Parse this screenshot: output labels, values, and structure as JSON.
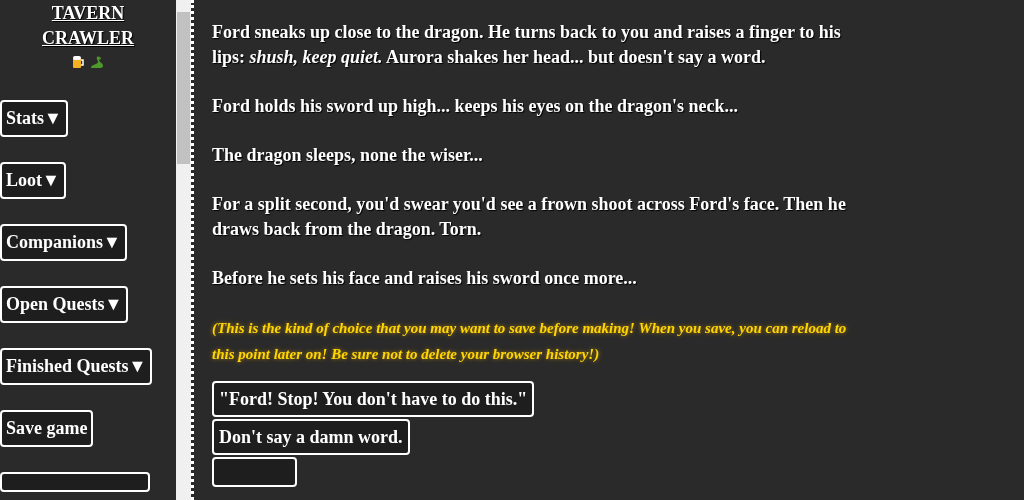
{
  "sidebar": {
    "title": "TAVERN CRAWLER",
    "buttons": [
      {
        "label": "Stats▼"
      },
      {
        "label": "Loot▼"
      },
      {
        "label": "Companions▼"
      },
      {
        "label": "Open Quests▼"
      },
      {
        "label": "Finished Quests▼"
      },
      {
        "label": "Save game"
      }
    ]
  },
  "story": {
    "paragraphs": [
      "Ford sneaks up close to the dragon. He turns back to you and raises a finger to his lips: *shush, keep quiet.* Aurora shakes her head... but doesn't say a word.",
      "Ford holds his sword up high... keeps his eyes on the dragon's neck...",
      "The dragon sleeps, none the wiser...",
      "For a split second, you'd swear you'd see a frown shoot across Ford's face. Then he draws back from the dragon. Torn.",
      "Before he sets his face and raises his sword once more..."
    ],
    "note": "(This is the kind of choice that you may want to save before making! When you save, you can reload to this point later on! Be sure not to delete your browser history!)",
    "choices": [
      {
        "label": "\"Ford! Stop! You don't have to do this.\""
      },
      {
        "label": "Don't say a damn word."
      }
    ]
  }
}
